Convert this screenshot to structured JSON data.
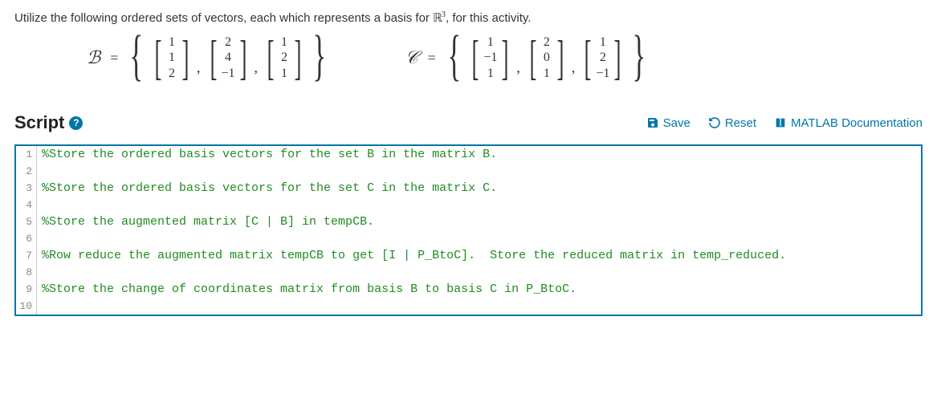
{
  "intro": {
    "prefix": "Utilize the following ordered sets of vectors, each which represents a basis for ",
    "space": "ℝ",
    "exp": "3",
    "suffix": ", for this activity."
  },
  "bases": {
    "B": {
      "name": "ℬ",
      "vectors": [
        [
          "1",
          "1",
          "2"
        ],
        [
          "2",
          "4",
          "−1"
        ],
        [
          "1",
          "2",
          "1"
        ]
      ]
    },
    "C": {
      "name": "𝒞",
      "vectors": [
        [
          "1",
          "−1",
          "1"
        ],
        [
          "2",
          "0",
          "1"
        ],
        [
          "1",
          "2",
          "−1"
        ]
      ]
    }
  },
  "script_header": {
    "title": "Script",
    "help": "?"
  },
  "toolbar": {
    "save": "Save",
    "reset": "Reset",
    "docs": "MATLAB Documentation"
  },
  "code_lines": [
    "%Store the ordered basis vectors for the set B in the matrix B.",
    "",
    "%Store the ordered basis vectors for the set C in the matrix C.",
    "",
    "%Store the augmented matrix [C | B] in tempCB.",
    "",
    "%Row reduce the augmented matrix tempCB to get [I | P_BtoC].  Store the reduced matrix in temp_reduced.",
    "",
    "%Store the change of coordinates matrix from basis B to basis C in P_BtoC.",
    ""
  ]
}
